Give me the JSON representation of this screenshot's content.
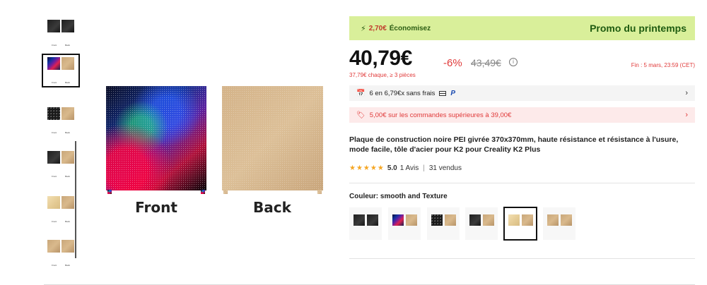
{
  "gallery": {
    "thumbnails": [
      {
        "front": "black",
        "back": "black",
        "front_label": "Front",
        "back_label": "Back",
        "selected": false
      },
      {
        "front": "colorful",
        "back": "gold",
        "front_label": "Front",
        "back_label": "Back",
        "selected": true
      },
      {
        "front": "speck",
        "back": "gold",
        "front_label": "Front",
        "back_label": "Back",
        "selected": false
      },
      {
        "front": "black",
        "back": "gold",
        "front_label": "Front",
        "back_label": "Back",
        "selected": false
      },
      {
        "front": "lightgold",
        "back": "gold",
        "front_label": "Front",
        "back_label": "Back",
        "selected": false
      },
      {
        "front": "gold",
        "back": "gold",
        "front_label": "Front",
        "back_label": "Back",
        "selected": false
      }
    ],
    "main_image": {
      "front_label": "Front",
      "back_label": "Back"
    }
  },
  "promo": {
    "savings_amount": "2,70€",
    "savings_text": "Économisez",
    "title": "Promo du printemps",
    "bolt_icon": "lightning-icon",
    "banner_color": "#d9ef9a"
  },
  "price": {
    "current": "40,79€",
    "discount": "-6%",
    "original": "43,49€",
    "info_icon": "info-icon",
    "ends": "Fin : 5 mars, 23:59 (CET)",
    "bulk": "37,79€ chaque, ≥ 3 pièces"
  },
  "payment": {
    "text": "6 en 6,79€x sans frais",
    "chevron": "›"
  },
  "coupon": {
    "text": "5,00€ sur les commandes supérieures à 39,00€",
    "chevron": "›"
  },
  "product": {
    "title": "Plaque de construction noire PEI givrée 370x370mm, haute résistance et résistance à l'usure, mode facile, tôle d'acier pour K2 pour Creality K2 Plus",
    "rating_stars": "★★★★★",
    "rating_score": "5.0",
    "reviews": "1 Avis",
    "sold": "31 vendus"
  },
  "color": {
    "label": "Couleur:",
    "value": "smooth and Texture",
    "options": [
      {
        "front": "black",
        "back": "black",
        "selected": false
      },
      {
        "front": "colorful",
        "back": "gold",
        "selected": false
      },
      {
        "front": "speck",
        "back": "gold",
        "selected": false
      },
      {
        "front": "black",
        "back": "gold",
        "selected": false
      },
      {
        "front": "lightgold",
        "back": "gold",
        "selected": true
      },
      {
        "front": "gold",
        "back": "gold",
        "selected": false
      }
    ]
  },
  "colors": {
    "accent_red": "#e03a3a",
    "promo_green": "#1e5b10",
    "star": "#f5a623"
  }
}
